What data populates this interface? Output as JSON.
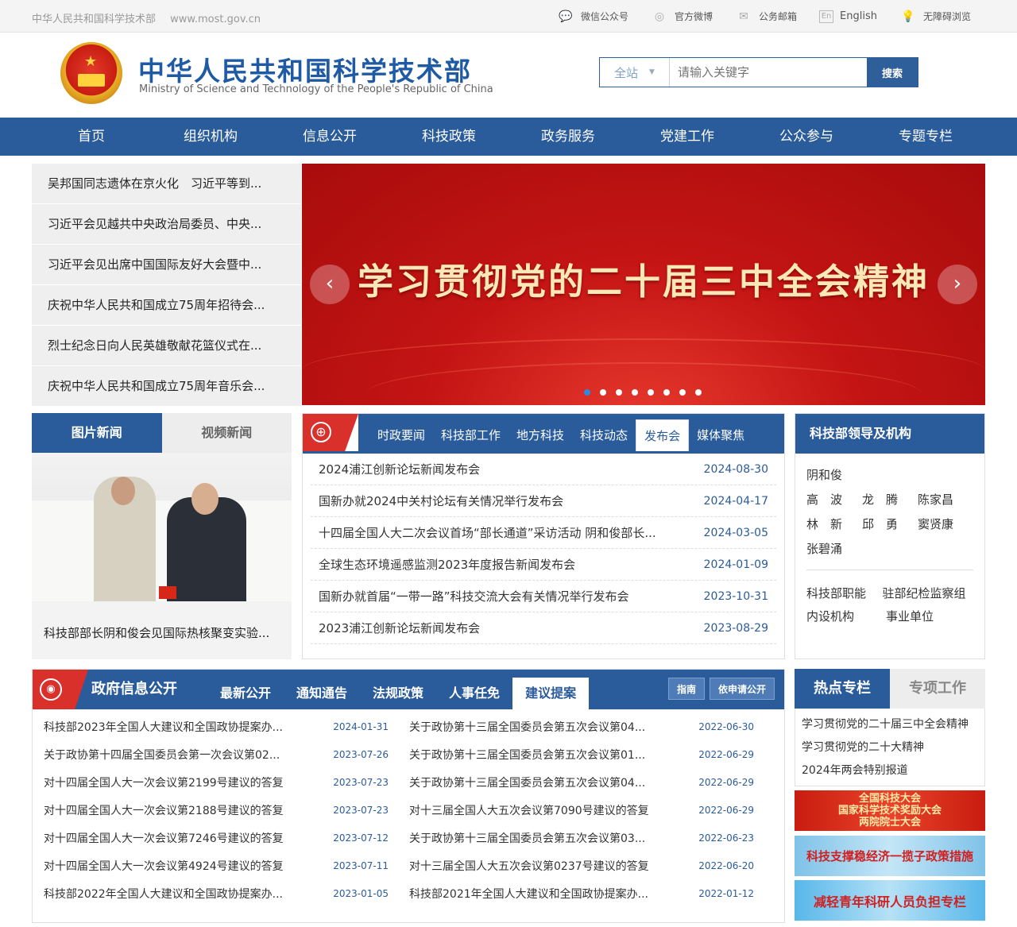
{
  "topbar": {
    "site_name": "中华人民共和国科学技术部",
    "site_url": "www.most.gov.cn",
    "links": [
      {
        "label": "微信公众号",
        "icon": "wechat-icon"
      },
      {
        "label": "官方微博",
        "icon": "weibo-icon"
      },
      {
        "label": "公务邮箱",
        "icon": "mail-icon"
      },
      {
        "label": "English",
        "icon": "english-icon"
      },
      {
        "label": "无障碍浏览",
        "icon": "accessibility-icon"
      }
    ]
  },
  "header": {
    "title_cn": "中华人民共和国科学技术部",
    "title_en": "Ministry of Science and Technology of the People's Republic of China",
    "search_scope": "全站",
    "search_placeholder": "请输入关键字",
    "search_button": "搜索"
  },
  "nav": [
    "首页",
    "组织机构",
    "信息公开",
    "科技政策",
    "政务服务",
    "党建工作",
    "公众参与",
    "专题专栏"
  ],
  "headlines": [
    "吴邦国同志遗体在京火化　习近平等到...",
    "习近平会见越共中央政治局委员、中央...",
    "习近平会见出席中国国际友好大会暨中...",
    "庆祝中华人民共和国成立75周年招待会...",
    "烈士纪念日向人民英雄敬献花篮仪式在...",
    "庆祝中华人民共和国成立75周年音乐会..."
  ],
  "banner": {
    "title": "学习贯彻党的二十届三中全会精神",
    "prev": "‹",
    "next": "›",
    "dot_count": 8,
    "active_dot": 0
  },
  "photo_news": {
    "tabs": [
      "图片新闻",
      "视频新闻"
    ],
    "caption": "科技部部长阴和俊会见国际热核聚变实验..."
  },
  "news": {
    "tabs": [
      "时政要闻",
      "科技部工作",
      "地方科技",
      "科技动态",
      "发布会",
      "媒体聚焦"
    ],
    "active_tab": 4,
    "items": [
      {
        "title": "2024浦江创新论坛新闻发布会",
        "date": "2024-08-30"
      },
      {
        "title": "国新办就2024中关村论坛有关情况举行发布会",
        "date": "2024-04-17"
      },
      {
        "title": "十四届全国人大二次会议首场“部长通道”采访活动 阴和俊部长...",
        "date": "2024-03-05"
      },
      {
        "title": "全球生态环境遥感监测2023年度报告新闻发布会",
        "date": "2024-01-09"
      },
      {
        "title": "国新办就首届“一带一路”科技交流大会有关情况举行发布会",
        "date": "2023-10-31"
      },
      {
        "title": "2023浦江创新论坛新闻发布会",
        "date": "2023-08-29"
      }
    ]
  },
  "leaders": {
    "title": "科技部领导及机构",
    "rows": [
      [
        "阴和俊"
      ],
      [
        "高　波",
        "龙　腾",
        "陈家昌"
      ],
      [
        "林　新",
        "邱　勇",
        "窦贤康"
      ],
      [
        "张碧涌"
      ]
    ],
    "orgs": [
      [
        "科技部职能",
        "驻部纪检监察组"
      ],
      [
        "内设机构",
        "事业单位"
      ]
    ]
  },
  "gov": {
    "title": "政府信息公开",
    "tabs": [
      "最新公开",
      "通知通告",
      "法规政策",
      "人事任免",
      "建议提案"
    ],
    "active_tab": 4,
    "buttons": [
      "指南",
      "依申请公开"
    ],
    "left": [
      {
        "title": "科技部2023年全国人大建议和全国政协提案办...",
        "date": "2024-01-31"
      },
      {
        "title": "关于政协第十四届全国委员会第一次会议第02...",
        "date": "2023-07-26"
      },
      {
        "title": "对十四届全国人大一次会议第2199号建议的答复",
        "date": "2023-07-23"
      },
      {
        "title": "对十四届全国人大一次会议第2188号建议的答复",
        "date": "2023-07-23"
      },
      {
        "title": "对十四届全国人大一次会议第7246号建议的答复",
        "date": "2023-07-12"
      },
      {
        "title": "对十四届全国人大一次会议第4924号建议的答复",
        "date": "2023-07-11"
      },
      {
        "title": "科技部2022年全国人大建议和全国政协提案办...",
        "date": "2023-01-05"
      }
    ],
    "right": [
      {
        "title": "关于政协第十三届全国委员会第五次会议第04...",
        "date": "2022-06-30"
      },
      {
        "title": "关于政协第十三届全国委员会第五次会议第01...",
        "date": "2022-06-29"
      },
      {
        "title": "关于政协第十三届全国委员会第五次会议第04...",
        "date": "2022-06-29"
      },
      {
        "title": "对十三届全国人大五次会议第7090号建议的答复",
        "date": "2022-06-29"
      },
      {
        "title": "关于政协第十三届全国委员会第五次会议第03...",
        "date": "2022-06-23"
      },
      {
        "title": "对十三届全国人大五次会议第0237号建议的答复",
        "date": "2022-06-20"
      },
      {
        "title": "科技部2021年全国人大建议和全国政协提案办...",
        "date": "2022-01-12"
      }
    ]
  },
  "hot": {
    "tabs": [
      "热点专栏",
      "专项工作"
    ],
    "items": [
      "学习贯彻党的二十届三中全会精神",
      "学习贯彻党的二十大精神",
      "2024年两会特别报道"
    ]
  },
  "promos": {
    "p1": [
      "全国科技大会",
      "国家科学技术奖励大会",
      "两院院士大会"
    ],
    "p2": "科技支撑稳经济一揽子政策措施",
    "p3": "减轻青年科研人员负担专栏"
  }
}
